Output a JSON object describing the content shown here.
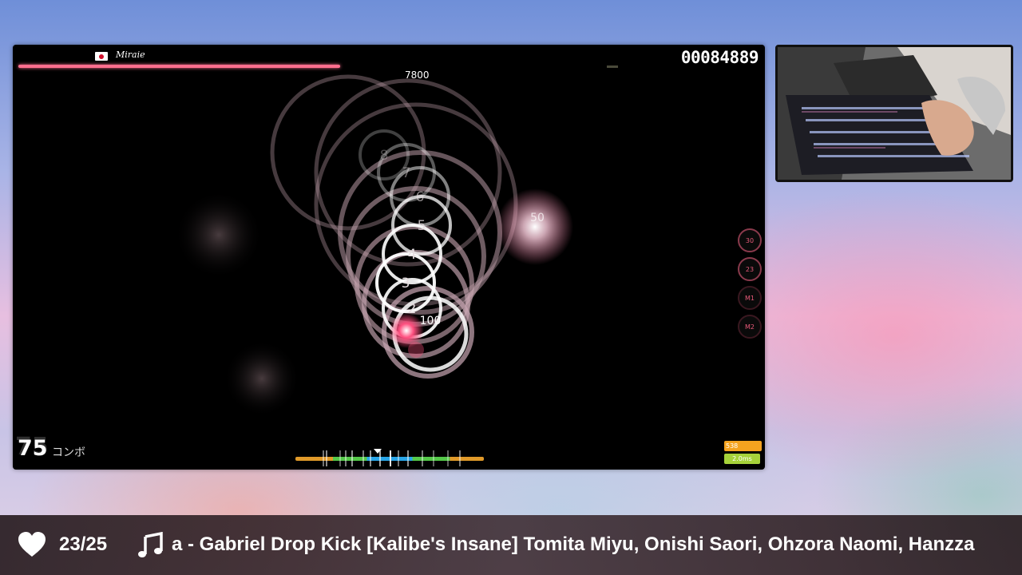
{
  "game": {
    "player_name": "Miraie",
    "score": "00084889",
    "pp_popup": "7800",
    "combo": "75",
    "combo_label": "コンボ",
    "hit_values": [
      "100",
      "50"
    ],
    "circle_numbers": [
      "8",
      "7",
      "6",
      "5",
      "4",
      "3",
      "2"
    ],
    "keys": [
      "30",
      "23",
      "M1",
      "M2"
    ],
    "stats": {
      "ur": "538",
      "ms": "2.0ms"
    },
    "health": 0.43
  },
  "footer": {
    "heart_icon": "heart-icon",
    "count": "23/25",
    "music_icon": "music-note-icon",
    "now_playing": "a - Gabriel Drop Kick [Kalibe's Insane] Tomita Miyu, Onishi Saori, Ohzora Naomi, Hanzza"
  },
  "colors": {
    "accent": "#ff6f8f",
    "ur_badge": "#f5a31f",
    "ms_badge": "#a6d23a"
  }
}
